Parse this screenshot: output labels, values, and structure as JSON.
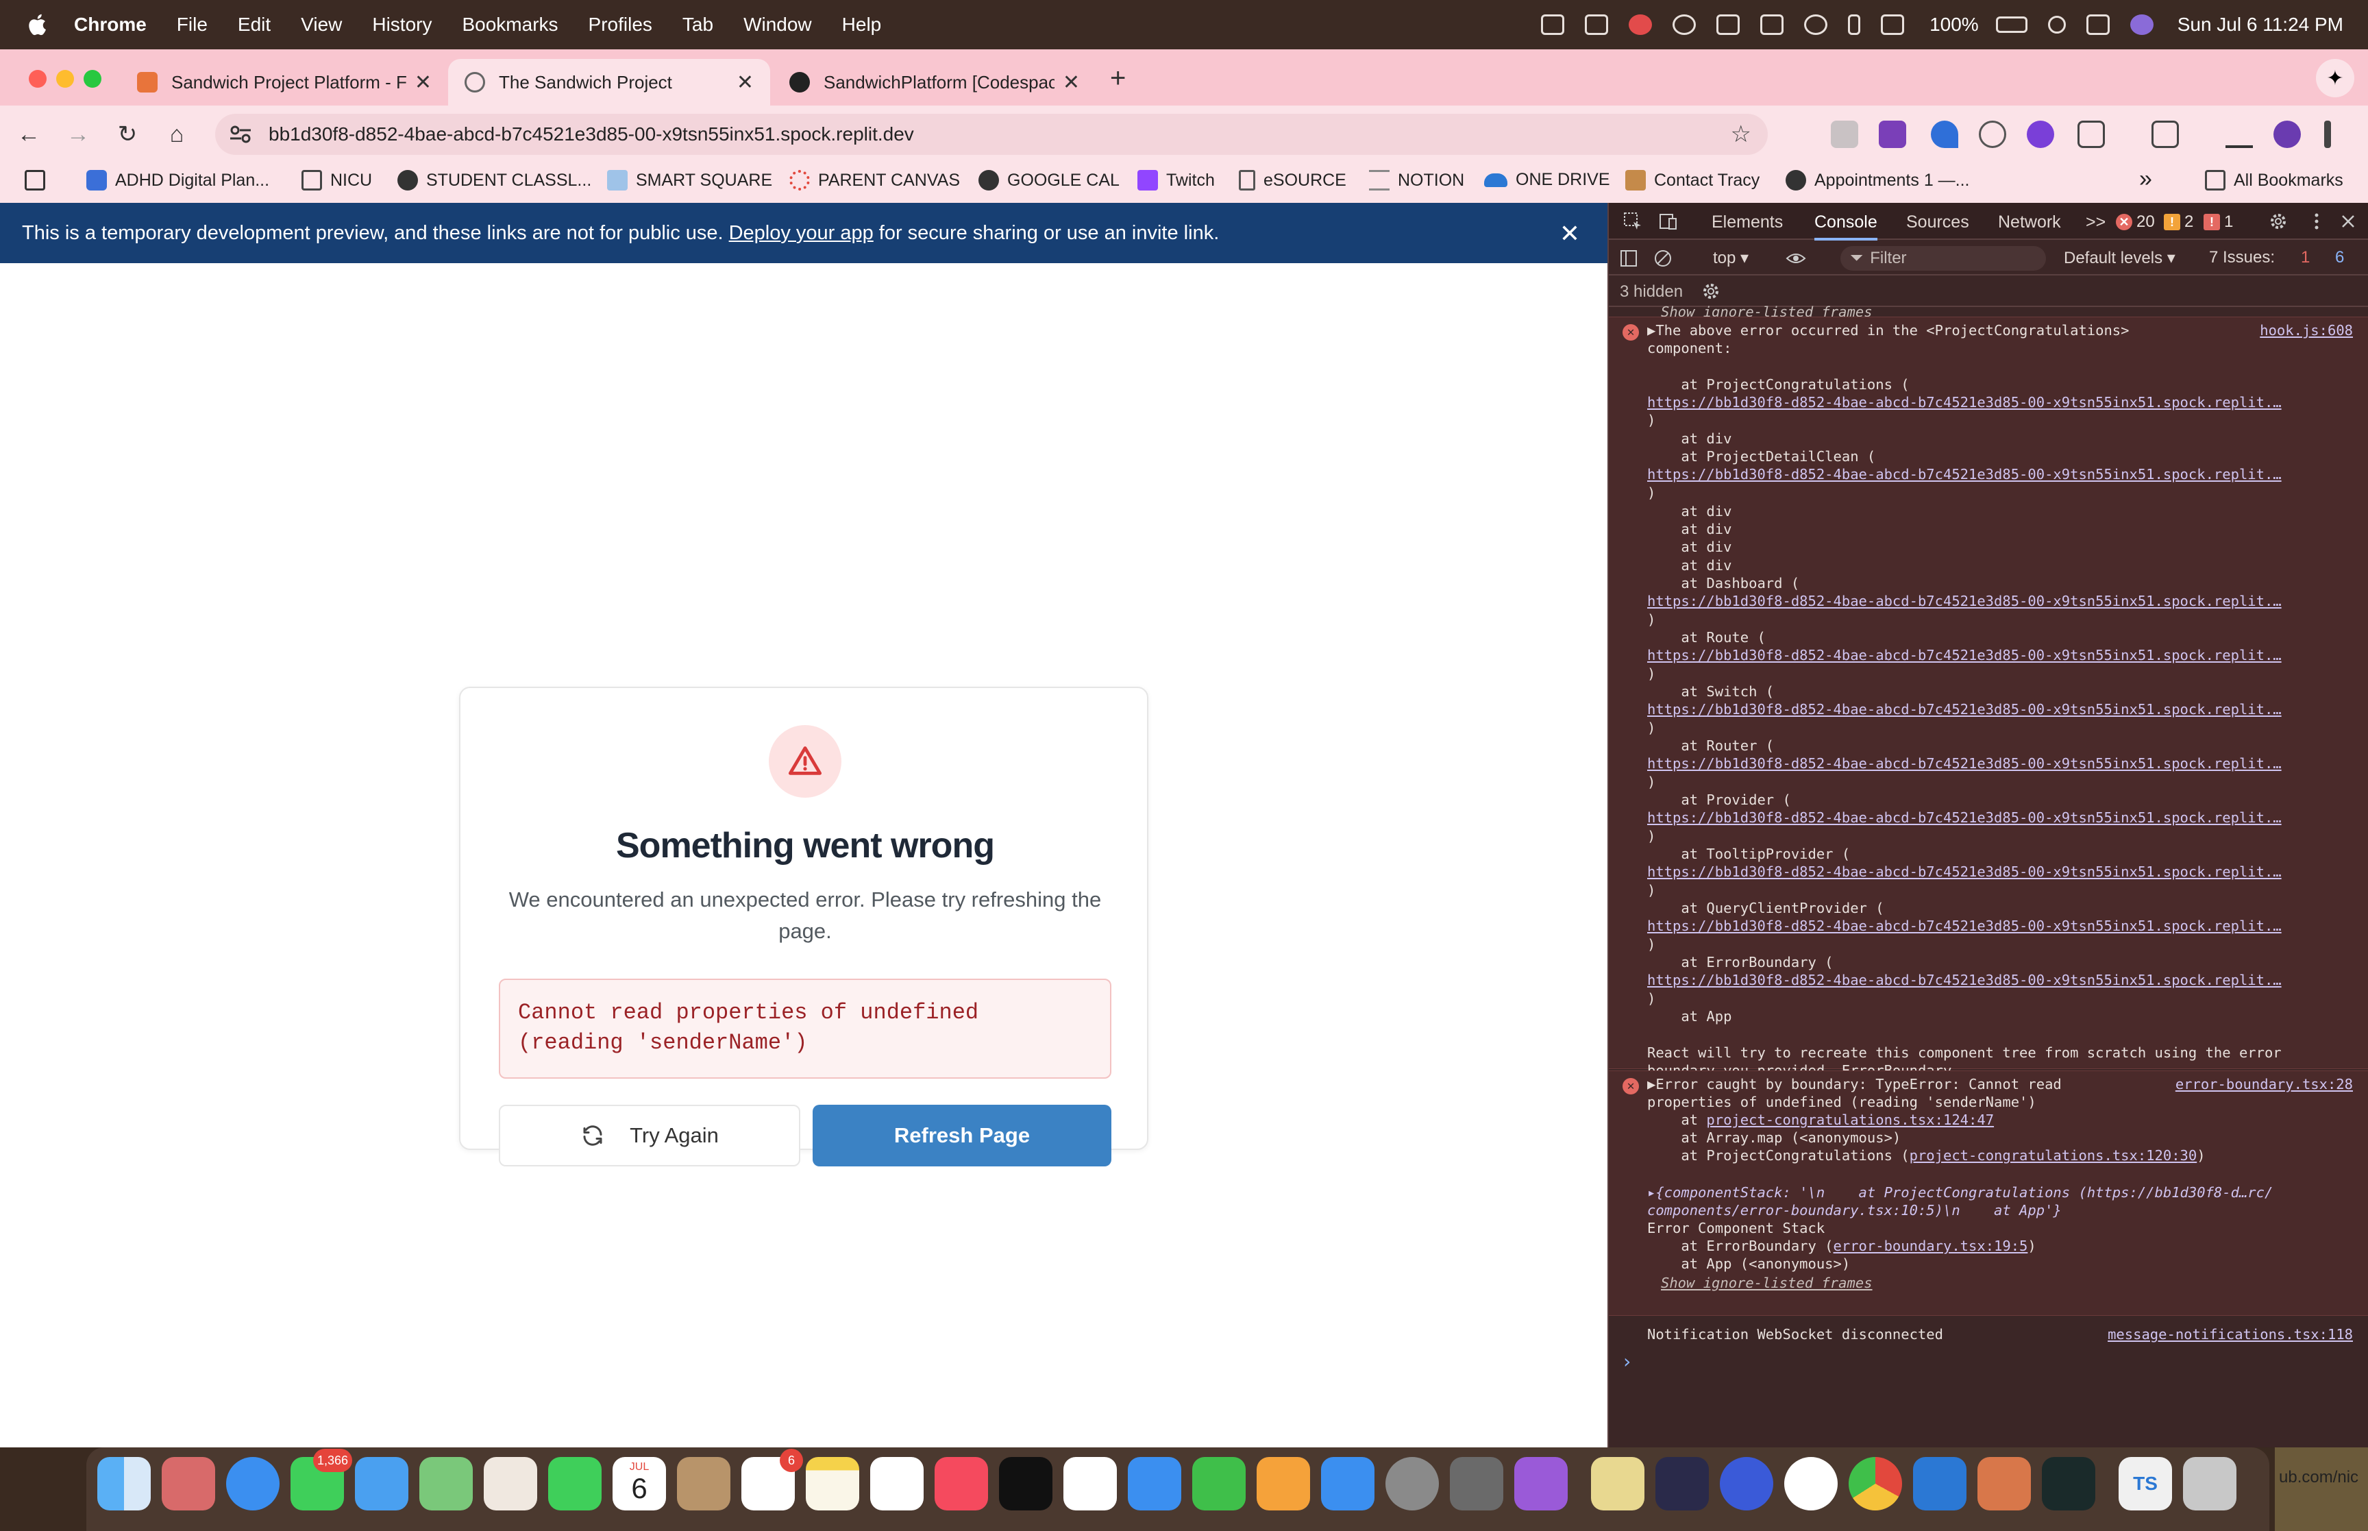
{
  "menubar": {
    "app": "Chrome",
    "items": [
      "File",
      "Edit",
      "View",
      "History",
      "Bookmarks",
      "Profiles",
      "Tab",
      "Window",
      "Help"
    ],
    "battery": "100%",
    "datetime": "Sun Jul 6  11:24 PM"
  },
  "tabs": [
    {
      "title": "Sandwich Project Platform - F",
      "active": false
    },
    {
      "title": "The Sandwich Project",
      "active": true
    },
    {
      "title": "SandwichPlatform [Codespac",
      "active": false
    }
  ],
  "new_tab": "+",
  "tab_search": "✦",
  "omnibox": {
    "url": "bb1d30f8-d852-4bae-abcd-b7c4521e3d85-00-x9tsn55inx51.spock.replit.dev"
  },
  "bookmarks": {
    "items": [
      {
        "label": "ADHD Digital Plan...",
        "color": "#3b6fd8"
      },
      {
        "label": "NICU",
        "color": "#d8c8c8"
      },
      {
        "label": "STUDENT CLASSL...",
        "color": "#333333"
      },
      {
        "label": "SMART SQUARE",
        "color": "#9fc3e8"
      },
      {
        "label": "PARENT CANVAS",
        "color": "#e2483d"
      },
      {
        "label": "GOOGLE CAL",
        "color": "#333333"
      },
      {
        "label": "Twitch",
        "color": "#9146ff"
      },
      {
        "label": "eSOURCE",
        "color": "#555555"
      },
      {
        "label": "NOTION",
        "color": "#888888"
      },
      {
        "label": "ONE DRIVE",
        "color": "#2b78d4"
      },
      {
        "label": "Contact Tracy",
        "color": "#c58a4a"
      },
      {
        "label": "Appointments 1 —...",
        "color": "#333333"
      }
    ],
    "overflow": "»",
    "all_bookmarks": "All Bookmarks"
  },
  "banner": {
    "text_before": "This is a temporary development preview, and these links are not for public use.",
    "link": "Deploy your app",
    "text_after": "for secure sharing or use an invite link.",
    "close": "✕"
  },
  "error_card": {
    "title": "Something went wrong",
    "description": "We encountered an unexpected error. Please try refreshing the page.",
    "error_message": "Cannot read properties of undefined (reading 'senderName')",
    "try_again": "Try Again",
    "refresh": "Refresh Page"
  },
  "devtools": {
    "tabs": [
      "Elements",
      "Console",
      "Sources",
      "Network"
    ],
    "active_tab": "Console",
    "more": ">>",
    "errors": "20",
    "warnings": "2",
    "issues_badge": "1",
    "context": "top ▾",
    "filter": "Filter",
    "levels": "Default levels ▾",
    "issues_label": "7 Issues:",
    "issues_err": "1",
    "issues_info": "6",
    "hidden": "3 hidden",
    "console": {
      "top_ignore": "Show ignore-listed frames",
      "error1_header_1": "▶The above error occurred in the <ProjectCongratulations>",
      "error1_header_2": "component:",
      "error1_source": "hook.js:608",
      "url": "https://bb1d30f8-d852-4bae-abcd-b7c4521e3d85-00-x9tsn55inx51.spock.replit.…",
      "frames": {
        "project_congratulations": "    at ProjectCongratulations (",
        "div": "    at div",
        "project_detail_clean": "    at ProjectDetailClean (",
        "dashboard": "    at Dashboard (",
        "route": "    at Route (",
        "switch": "    at Switch (",
        "router": "    at Router (",
        "provider": "    at Provider (",
        "tooltip_provider": "    at TooltipProvider (",
        "query_client_provider": "    at QueryClientProvider (",
        "error_boundary": "    at ErrorBoundary (",
        "app": "    at App",
        "close_paren": ")"
      },
      "react_msg_1": "React will try to recreate this component tree from scratch using the error",
      "react_msg_2": "boundary you provided, ErrorBoundary.",
      "error2_header_1": "▶Error caught by boundary: TypeError: Cannot read",
      "error2_header_2": "properties of undefined (reading 'senderName')",
      "error2_source": "error-boundary.tsx:28",
      "e2_at_1": "    at ",
      "e2_link_1": "project-congratulations.tsx:124:47",
      "e2_at_2": "    at Array.map (<anonymous>)",
      "e2_at_3": "    at ProjectCongratulations (",
      "e2_link_3": "project-congratulations.tsx:120:30",
      "e2_close": ")",
      "component_stack_1": "▸{componentStack: '\\n    at ProjectCongratulations (https://bb1d30f8-d…rc/",
      "component_stack_2": "components/error-boundary.tsx:10:5)\\n    at App'}",
      "ecs_title": "Error Component Stack",
      "ecs_1_prefix": "    at ErrorBoundary (",
      "ecs_1_link": "error-boundary.tsx:19:5",
      "ecs_1_suffix": ")",
      "ecs_2": "    at App (<anonymous>)",
      "bottom_ignore": "Show ignore-listed frames",
      "websocket": "Notification WebSocket disconnected",
      "websocket_source": "message-notifications.tsx:118",
      "prompt": "›"
    }
  },
  "dock": {
    "messages_badge": "1,366",
    "reminders_badge": "6",
    "calendar_month": "JUL",
    "calendar_day": "6",
    "trailing_text": "ub.com/nic",
    "ts_label": "TS"
  },
  "colors": {
    "menubar": "#3b2a23",
    "tabstrip": "#f9c6d0",
    "banner": "#173f73",
    "refresh_button": "#3b82c4",
    "devtools_bg": "#3b2626",
    "error_text": "#9b2226"
  }
}
